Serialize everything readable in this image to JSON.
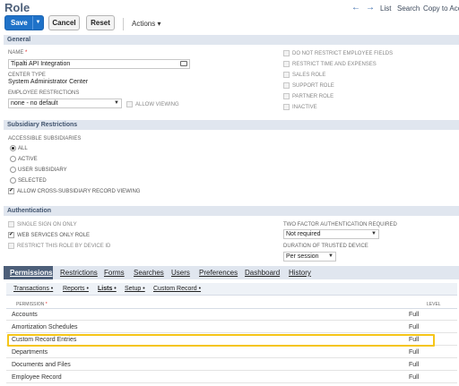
{
  "header": {
    "title": "Role",
    "nav_back": "←",
    "nav_forward": "→",
    "nav_list": "List",
    "nav_search": "Search",
    "nav_copy": "Copy to Acco"
  },
  "toolbar": {
    "save_label": "Save",
    "save_arrow": "▼",
    "cancel_label": "Cancel",
    "reset_label": "Reset",
    "actions_label": "Actions ▾"
  },
  "general": {
    "section_title": "General",
    "name_label": "NAME",
    "name_required": "*",
    "name_value": "Tipalti API Integration",
    "center_type_label": "CENTER TYPE",
    "center_type_value": "System Administrator Center",
    "employee_restrictions_label": "EMPLOYEE RESTRICTIONS",
    "employee_restrictions_value": "none - no default",
    "allow_viewing_label": "ALLOW VIEWING",
    "right_checkboxes": [
      {
        "label": "DO NOT RESTRICT EMPLOYEE FIELDS",
        "checked": false
      },
      {
        "label": "RESTRICT TIME AND EXPENSES",
        "checked": false
      },
      {
        "label": "SALES ROLE",
        "checked": false
      },
      {
        "label": "SUPPORT ROLE",
        "checked": false
      },
      {
        "label": "PARTNER ROLE",
        "checked": false
      },
      {
        "label": "INACTIVE",
        "checked": false
      }
    ]
  },
  "subsidiary": {
    "section_title": "Subsidiary Restrictions",
    "accessible_label": "ACCESSIBLE SUBSIDIARIES",
    "options": [
      {
        "label": "ALL",
        "selected": true
      },
      {
        "label": "ACTIVE",
        "selected": false
      },
      {
        "label": "USER SUBSIDIARY",
        "selected": false
      },
      {
        "label": "SELECTED",
        "selected": false
      }
    ],
    "cross_subsidiary_label": "ALLOW CROSS-SUBSIDIARY RECORD VIEWING",
    "cross_subsidiary_checked": true
  },
  "authentication": {
    "section_title": "Authentication",
    "single_sign_on_label": "SINGLE SIGN ON ONLY",
    "web_services_label": "WEB SERVICES ONLY ROLE",
    "web_services_checked": true,
    "restrict_device_label": "RESTRICT THIS ROLE BY DEVICE ID",
    "two_factor_label": "TWO FACTOR AUTHENTICATION REQUIRED",
    "two_factor_value": "Not required",
    "duration_label": "DURATION OF TRUSTED DEVICE",
    "duration_value": "Per session"
  },
  "tabs": [
    "Permissions",
    "Restrictions",
    "Forms",
    "Searches",
    "Users",
    "Preferences",
    "Dashboard",
    "History"
  ],
  "subtabs": [
    "Transactions •",
    "Reports •",
    "Lists •",
    "Setup •",
    "Custom Record •"
  ],
  "permissions_table": {
    "col_permission": "PERMISSION",
    "col_required": "*",
    "col_level": "LEVEL",
    "rows": [
      {
        "name": "Accounts",
        "level": "Full"
      },
      {
        "name": "Amortization Schedules",
        "level": "Full"
      },
      {
        "name": "Custom Record Entries",
        "level": "Full"
      },
      {
        "name": "Departments",
        "level": "Full"
      },
      {
        "name": "Documents and Files",
        "level": "Full"
      },
      {
        "name": "Employee Record",
        "level": "Full"
      }
    ]
  },
  "colors": {
    "accent": "#1f72c8",
    "section_bar": "#e0e6ef",
    "highlight": "#f5c518"
  }
}
